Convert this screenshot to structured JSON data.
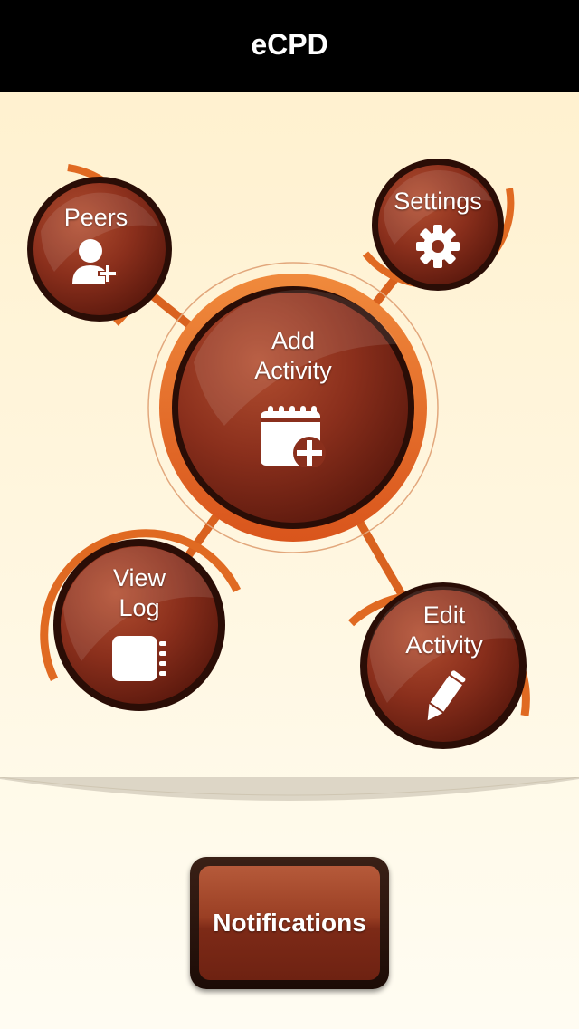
{
  "navbar": {
    "title": "eCPD"
  },
  "hub": {
    "center": {
      "line1": "Add",
      "line2": "Activity",
      "icon": "calendar-add-icon"
    },
    "peers": {
      "label": "Peers",
      "icon": "add-user-icon"
    },
    "settings": {
      "label": "Settings",
      "icon": "gear-icon"
    },
    "view_log": {
      "line1": "View",
      "line2": "Log",
      "icon": "notebook-icon"
    },
    "edit_activity": {
      "line1": "Edit",
      "line2": "Activity",
      "icon": "pencil-icon"
    }
  },
  "notifications": {
    "label": "Notifications"
  },
  "colors": {
    "navbar": "#000000",
    "accent": "#e8732a",
    "button_dark": "#7d2a17"
  }
}
